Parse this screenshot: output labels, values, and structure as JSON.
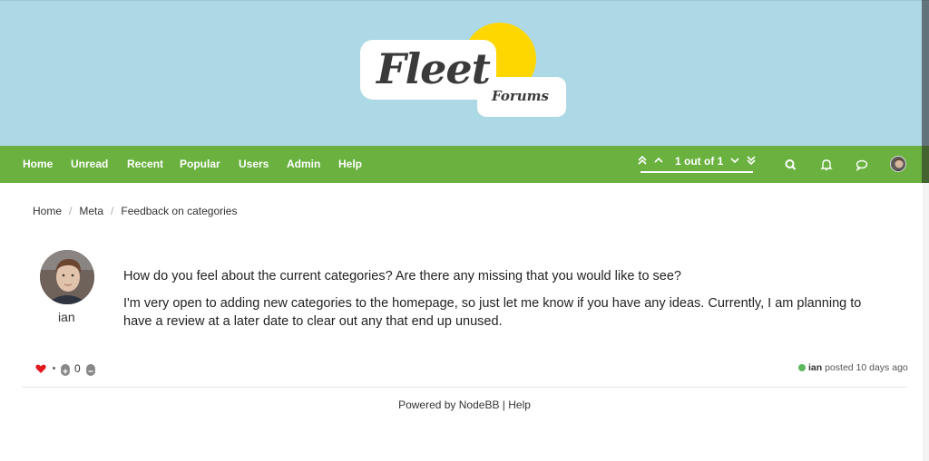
{
  "logo": {
    "main": "Fleet",
    "sub": "Forums"
  },
  "nav": {
    "items": [
      {
        "label": "Home"
      },
      {
        "label": "Unread"
      },
      {
        "label": "Recent"
      },
      {
        "label": "Popular"
      },
      {
        "label": "Users"
      },
      {
        "label": "Admin"
      },
      {
        "label": "Help"
      }
    ],
    "pager": {
      "text": "1 out of 1"
    },
    "icons": [
      "search-icon",
      "bell-icon",
      "chat-icon",
      "user-avatar"
    ]
  },
  "breadcrumb": {
    "items": [
      "Home",
      "Meta",
      "Feedback on categories"
    ],
    "separator": "/"
  },
  "post": {
    "username": "ian",
    "paragraph1": "How do you feel about the current categories? Are there any missing that you would like to see?",
    "paragraph2": "I'm very open to adding new categories to the homepage, so just let me know if you have any ideas. Currently, I am planning to have a review at a later date to clear out any that end up unused.",
    "votes": "0",
    "author": "ian",
    "posted_text": "posted 10 days ago",
    "status_color": "#5cb85c"
  },
  "footer": {
    "text": "Powered by NodeBB | Help"
  },
  "colors": {
    "header_bg": "#add8e6",
    "nav_bg": "#6ab140",
    "sun": "#ffd700",
    "heart": "#e0191f"
  }
}
